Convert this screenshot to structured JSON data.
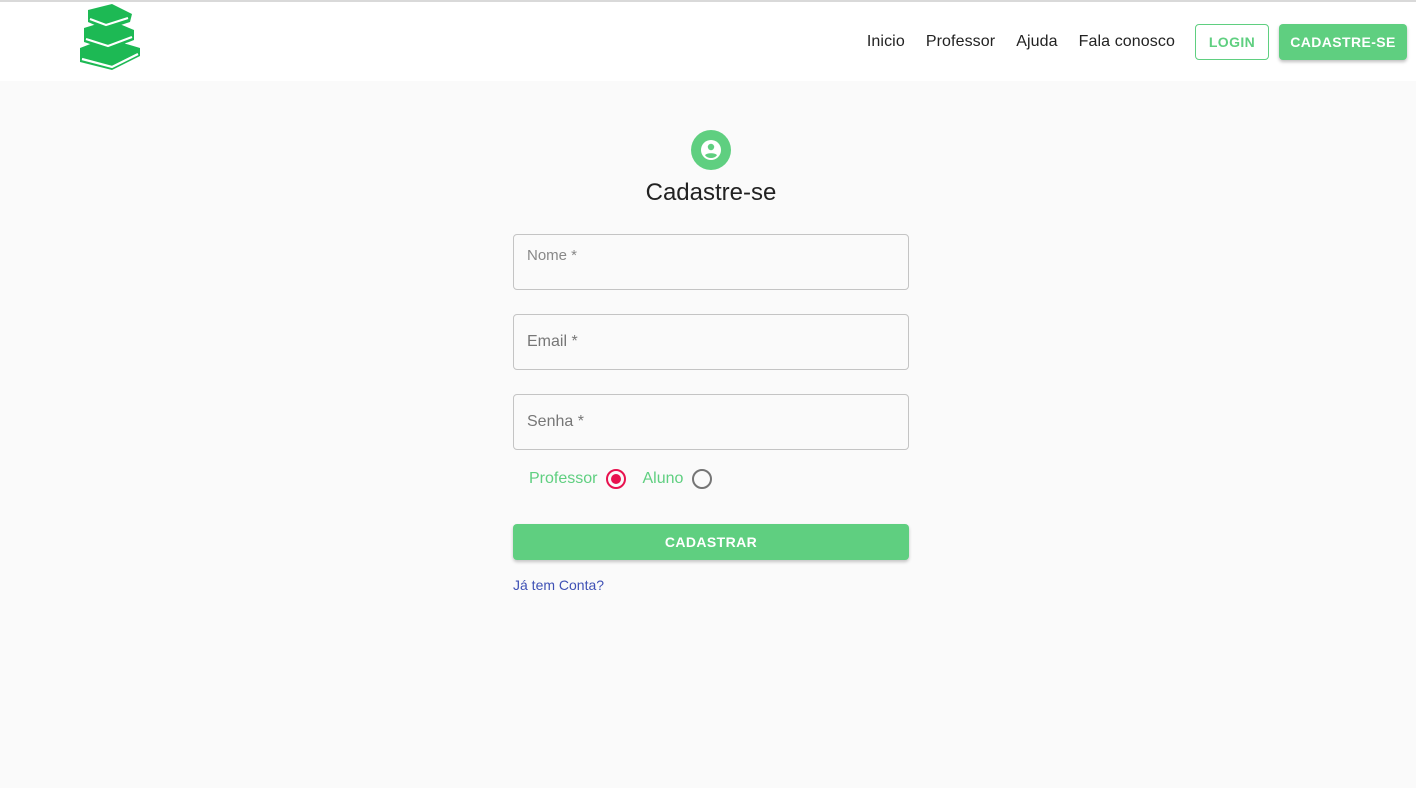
{
  "header": {
    "nav": [
      "Inicio",
      "Professor",
      "Ajuda",
      "Fala conosco"
    ],
    "login_label": "LOGIN",
    "signup_label": "CADASTRE-SE"
  },
  "form": {
    "title": "Cadastre-se",
    "fields": {
      "name_label": "Nome *",
      "email_label": "Email *",
      "password_label": "Senha *"
    },
    "roles": [
      {
        "label": "Professor",
        "selected": true
      },
      {
        "label": "Aluno",
        "selected": false
      }
    ],
    "submit_label": "CADASTRAR",
    "login_link": "Já tem Conta?"
  },
  "colors": {
    "brand": "#5fcf80",
    "logo": "#1db954",
    "radio_selected": "#e8124f",
    "link": "#3f51b5"
  },
  "icons": {
    "logo": "books-stack-icon",
    "avatar": "account-circle-icon"
  }
}
